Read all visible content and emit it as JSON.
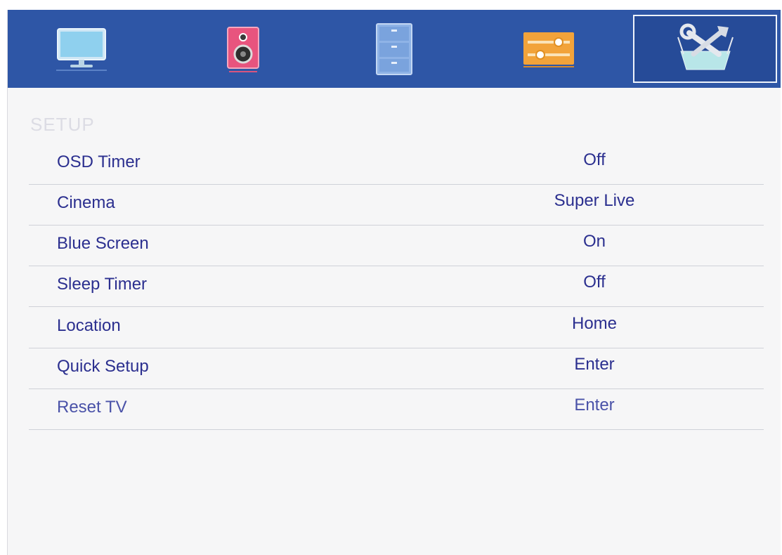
{
  "colors": {
    "topbar": "#2e56a6",
    "text": "#2b2f8f",
    "section_title": "#dcdce4",
    "background": "#f6f6f7"
  },
  "tabs": [
    {
      "icon": "monitor-icon",
      "selected": false
    },
    {
      "icon": "speaker-icon",
      "selected": false
    },
    {
      "icon": "cabinet-icon",
      "selected": false
    },
    {
      "icon": "sliders-icon",
      "selected": false
    },
    {
      "icon": "tools-icon",
      "selected": true
    }
  ],
  "section": {
    "title": "SETUP"
  },
  "rows": [
    {
      "label": "OSD Timer",
      "value": "Off"
    },
    {
      "label": "Cinema",
      "value": "Super Live"
    },
    {
      "label": "Blue Screen",
      "value": "On"
    },
    {
      "label": "Sleep Timer",
      "value": "Off"
    },
    {
      "label": "Location",
      "value": "Home"
    },
    {
      "label": "Quick Setup",
      "value": "Enter"
    },
    {
      "label": "Reset TV",
      "value": "Enter"
    }
  ]
}
